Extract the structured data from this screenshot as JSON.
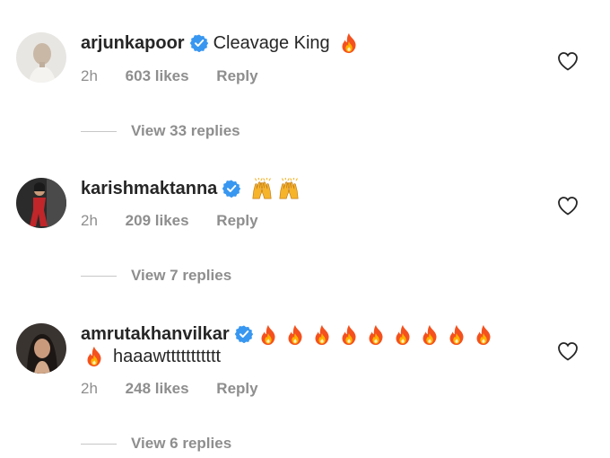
{
  "comments": [
    {
      "username": "arjunkapoor",
      "text": "Cleavage King",
      "emoji": [
        "fire"
      ],
      "time": "2h",
      "likes": "603 likes",
      "reply": "Reply",
      "view_replies": "View 33 replies",
      "avatar": "bald-man-avatar"
    },
    {
      "username": "karishmaktanna",
      "text": "",
      "emoji": [
        "raising-hands",
        "raising-hands"
      ],
      "time": "2h",
      "likes": "209 likes",
      "reply": "Reply",
      "view_replies": "View 7 replies",
      "avatar": "woman-in-red-avatar"
    },
    {
      "username": "amrutakhanvilkar",
      "text": "haaawttttttttttt",
      "emoji": [
        "fire",
        "fire",
        "fire",
        "fire",
        "fire",
        "fire",
        "fire",
        "fire",
        "fire",
        "fire"
      ],
      "time": "2h",
      "likes": "248 likes",
      "reply": "Reply",
      "view_replies": "View 6 replies",
      "avatar": "woman-portrait-avatar"
    }
  ],
  "colors": {
    "text": "#262626",
    "muted": "#8e8e8e",
    "verified": "#3897f0",
    "divider": "#c7c7c7"
  }
}
